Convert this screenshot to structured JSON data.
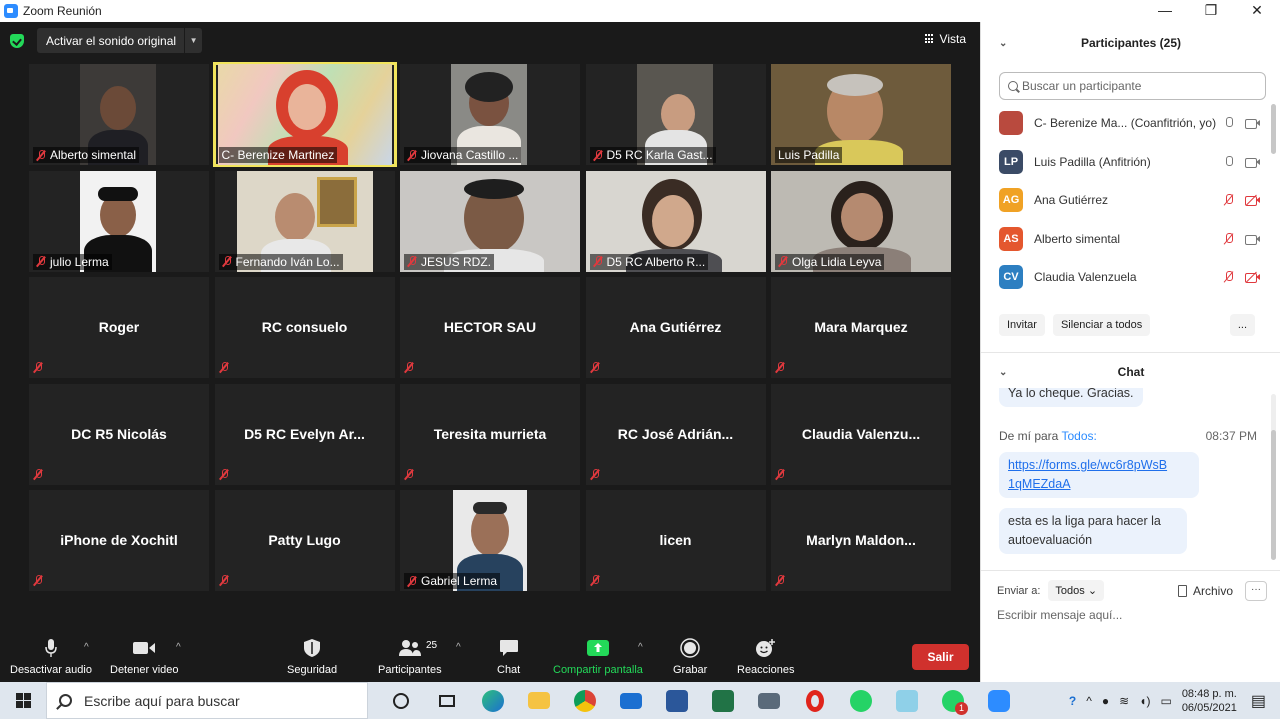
{
  "window": {
    "title": "Zoom Reunión",
    "minimize": "—",
    "maximize": "❐",
    "close": "✕"
  },
  "meeting": {
    "audio_button_label": "Activar el sonido original",
    "view_label": "Vista"
  },
  "video_tiles": [
    {
      "name": "Alberto simental",
      "type": "video",
      "muted": true
    },
    {
      "name": "C- Berenize Martinez",
      "type": "video",
      "muted": false,
      "active": true
    },
    {
      "name": "Jiovana Castillo ...",
      "type": "video",
      "muted": true
    },
    {
      "name": "D5 RC Karla Gast...",
      "type": "video",
      "muted": true
    },
    {
      "name": "Luis Padilla",
      "type": "video",
      "muted": false
    },
    {
      "name": "julio Lerma",
      "type": "video",
      "muted": true
    },
    {
      "name": "Fernando Iván Lo...",
      "type": "video",
      "muted": true
    },
    {
      "name": "JESUS RDZ.",
      "type": "video",
      "muted": true
    },
    {
      "name": "D5 RC Alberto R...",
      "type": "video",
      "muted": true
    },
    {
      "name": "Olga Lidia Leyva",
      "type": "video",
      "muted": true
    },
    {
      "name": "Roger",
      "type": "name"
    },
    {
      "name": "RC consuelo",
      "type": "name"
    },
    {
      "name": "HECTOR SAU",
      "type": "name"
    },
    {
      "name": "Ana Gutiérrez",
      "type": "name"
    },
    {
      "name": "Mara Marquez",
      "type": "name"
    },
    {
      "name": "DC R5 Nicolás",
      "type": "name"
    },
    {
      "name": "D5  RC Evelyn Ar...",
      "type": "name"
    },
    {
      "name": "Teresita murrieta",
      "type": "name"
    },
    {
      "name": "RC  José Adrián...",
      "type": "name"
    },
    {
      "name": "Claudia  Valenzu...",
      "type": "name"
    },
    {
      "name": "iPhone de Xochitl",
      "type": "name"
    },
    {
      "name": "Patty Lugo",
      "type": "name"
    },
    {
      "name": "Gabriel Lerma",
      "type": "video",
      "muted": true
    },
    {
      "name": "licen",
      "type": "name"
    },
    {
      "name": "Marlyn  Maldon...",
      "type": "name"
    }
  ],
  "toolbar": {
    "mute_label": "Desactivar audio",
    "video_label": "Detener video",
    "security_label": "Seguridad",
    "participants_label": "Participantes",
    "participants_count": "25",
    "chat_label": "Chat",
    "share_label": "Compartir pantalla",
    "record_label": "Grabar",
    "reactions_label": "Reacciones",
    "exit_label": "Salir"
  },
  "participants_panel": {
    "title": "Participantes (25)",
    "search_placeholder": "Buscar un participante",
    "list": [
      {
        "initials": "",
        "name": "C- Berenize Ma... (Coanfitrión, yo)",
        "color": "#b94a3e",
        "mic_off": false,
        "video_off": false
      },
      {
        "initials": "LP",
        "name": "Luis Padilla (Anfitrión)",
        "color": "#3b4b66",
        "mic_off": false,
        "video_off": false
      },
      {
        "initials": "AG",
        "name": "Ana Gutiérrez",
        "color": "#f0a225",
        "mic_off": true,
        "video_off": true
      },
      {
        "initials": "AS",
        "name": "Alberto simental",
        "color": "#e4572e",
        "mic_off": true,
        "video_off": false
      },
      {
        "initials": "CV",
        "name": "Claudia Valenzuela",
        "color": "#2d7fc1",
        "mic_off": true,
        "video_off": true
      }
    ],
    "invite_label": "Invitar",
    "mute_all_label": "Silenciar a todos",
    "more_label": "..."
  },
  "chat": {
    "title": "Chat",
    "prev_message": "Ya lo cheque. Gracias.",
    "from_label": "De mí para",
    "to_label": "Todos:",
    "time": "08:37 PM",
    "link_line1": "https://forms.gle/wc6r8pWsB",
    "link_line2": "1qMEZdaA",
    "message_line1": "esta es la liga para hacer la",
    "message_line2": "autoevaluación",
    "send_to_label": "Enviar a:",
    "send_to_value": "Todos",
    "file_label": "Archivo",
    "more_label": "···",
    "input_placeholder": "Escribir mensaje aquí..."
  },
  "taskbar": {
    "search_placeholder": "Escribe aquí para buscar",
    "time": "08:48 p. m.",
    "date": "06/05/2021",
    "whatsapp_badge": "1"
  },
  "colors": {
    "accent_green": "#23d959",
    "active_speaker": "#f1e45c",
    "exit_red": "#d0312d",
    "zoom_blue": "#2d8cff"
  }
}
